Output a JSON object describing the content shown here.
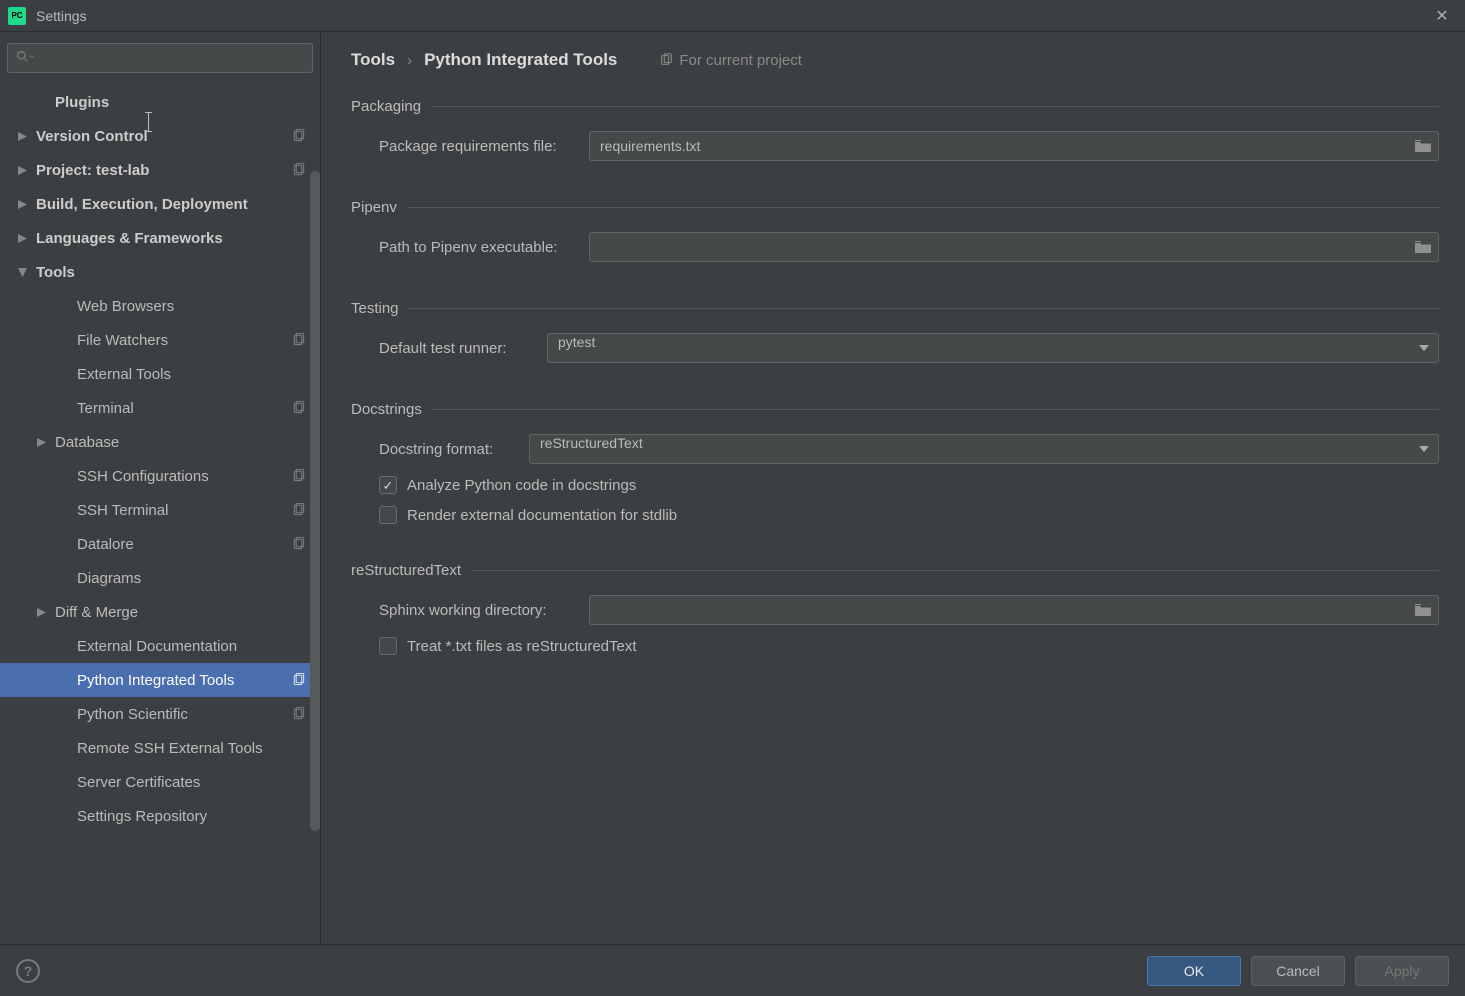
{
  "window": {
    "title": "Settings"
  },
  "sidebar": {
    "search_placeholder": "",
    "items": [
      {
        "label": "Plugins",
        "level": 1,
        "arrow": "none",
        "bold": true,
        "badge": false
      },
      {
        "label": "Version Control",
        "level": 0,
        "arrow": "right",
        "bold": true,
        "badge": true
      },
      {
        "label": "Project: test-lab",
        "level": 0,
        "arrow": "right",
        "bold": true,
        "badge": true
      },
      {
        "label": "Build, Execution, Deployment",
        "level": 0,
        "arrow": "right",
        "bold": true,
        "badge": false
      },
      {
        "label": "Languages & Frameworks",
        "level": 0,
        "arrow": "right",
        "bold": true,
        "badge": false
      },
      {
        "label": "Tools",
        "level": 0,
        "arrow": "down",
        "bold": true,
        "badge": false
      },
      {
        "label": "Web Browsers",
        "level": 2,
        "arrow": "none",
        "bold": false,
        "badge": false
      },
      {
        "label": "File Watchers",
        "level": 2,
        "arrow": "none",
        "bold": false,
        "badge": true
      },
      {
        "label": "External Tools",
        "level": 2,
        "arrow": "none",
        "bold": false,
        "badge": false
      },
      {
        "label": "Terminal",
        "level": 2,
        "arrow": "none",
        "bold": false,
        "badge": true
      },
      {
        "label": "Database",
        "level": 2,
        "arrow": "right",
        "bold": false,
        "badge": false,
        "arrowLevel": 1
      },
      {
        "label": "SSH Configurations",
        "level": 2,
        "arrow": "none",
        "bold": false,
        "badge": true
      },
      {
        "label": "SSH Terminal",
        "level": 2,
        "arrow": "none",
        "bold": false,
        "badge": true
      },
      {
        "label": "Datalore",
        "level": 2,
        "arrow": "none",
        "bold": false,
        "badge": true
      },
      {
        "label": "Diagrams",
        "level": 2,
        "arrow": "none",
        "bold": false,
        "badge": false
      },
      {
        "label": "Diff & Merge",
        "level": 2,
        "arrow": "right",
        "bold": false,
        "badge": false,
        "arrowLevel": 1
      },
      {
        "label": "External Documentation",
        "level": 2,
        "arrow": "none",
        "bold": false,
        "badge": false
      },
      {
        "label": "Python Integrated Tools",
        "level": 2,
        "arrow": "none",
        "bold": false,
        "badge": true,
        "selected": true
      },
      {
        "label": "Python Scientific",
        "level": 2,
        "arrow": "none",
        "bold": false,
        "badge": true
      },
      {
        "label": "Remote SSH External Tools",
        "level": 2,
        "arrow": "none",
        "bold": false,
        "badge": false
      },
      {
        "label": "Server Certificates",
        "level": 2,
        "arrow": "none",
        "bold": false,
        "badge": false
      },
      {
        "label": "Settings Repository",
        "level": 2,
        "arrow": "none",
        "bold": false,
        "badge": false
      }
    ]
  },
  "breadcrumb": {
    "root": "Tools",
    "leaf": "Python Integrated Tools",
    "scope": "For current project"
  },
  "sections": {
    "packaging": {
      "legend": "Packaging",
      "req_label": "Package requirements file:",
      "req_value": "requirements.txt"
    },
    "pipenv": {
      "legend": "Pipenv",
      "path_label": "Path to Pipenv executable:",
      "path_value": ""
    },
    "testing": {
      "legend": "Testing",
      "runner_label": "Default test runner:",
      "runner_value": "pytest"
    },
    "docstrings": {
      "legend": "Docstrings",
      "format_label": "Docstring format:",
      "format_value": "reStructuredText",
      "analyze_label": "Analyze Python code in docstrings",
      "render_label": "Render external documentation for stdlib"
    },
    "rst": {
      "legend": "reStructuredText",
      "sphinx_label": "Sphinx working directory:",
      "sphinx_value": "",
      "treat_label": "Treat *.txt files as reStructuredText"
    }
  },
  "footer": {
    "ok": "OK",
    "cancel": "Cancel",
    "apply": "Apply"
  }
}
